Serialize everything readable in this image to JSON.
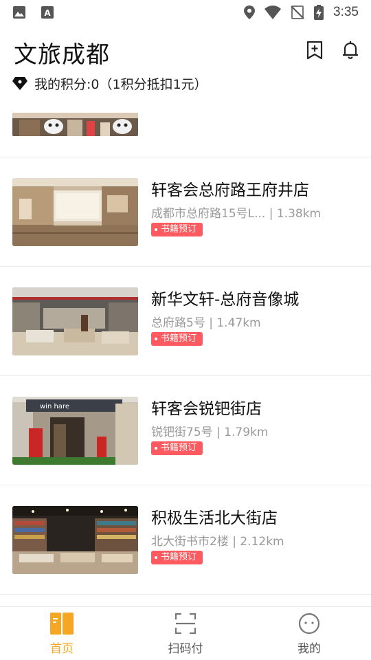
{
  "status_bar": {
    "time": "3:35"
  },
  "header": {
    "title": "文旅成都",
    "points_text": "我的积分:0（1积分抵扣1元）"
  },
  "stores": [
    {
      "name": "轩客会总府路王府井店",
      "address_distance": "成都市总府路15号L... | 1.38km",
      "tag": "书籍预订"
    },
    {
      "name": "新华文轩-总府音像城",
      "address_distance": "总府路5号 | 1.47km",
      "tag": "书籍预订"
    },
    {
      "name": "轩客会锐钯街店",
      "address_distance": "锐钯街75号 | 1.79km",
      "tag": "书籍预订"
    },
    {
      "name": "积极生活北大街店",
      "address_distance": "北大街书市2楼 | 2.12km",
      "tag": "书籍预订"
    }
  ],
  "bottom_nav": [
    {
      "label": "首页",
      "icon": "home-book-icon",
      "active": true
    },
    {
      "label": "扫码付",
      "icon": "scan-icon",
      "active": false
    },
    {
      "label": "我的",
      "icon": "profile-icon",
      "active": false
    }
  ],
  "colors": {
    "accent": "#f5a623",
    "tag": "#ff5a5f"
  }
}
